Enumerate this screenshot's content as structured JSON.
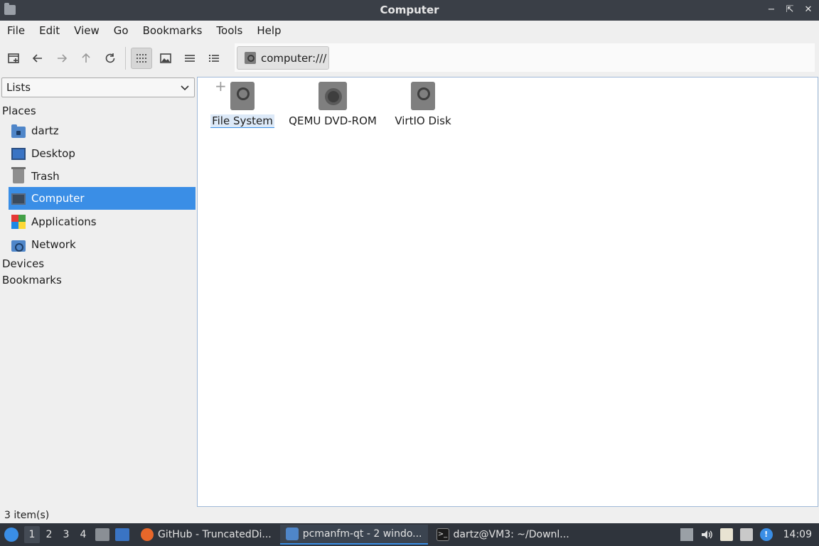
{
  "window": {
    "title": "Computer"
  },
  "menu": [
    "File",
    "Edit",
    "View",
    "Go",
    "Bookmarks",
    "Tools",
    "Help"
  ],
  "path": {
    "value": "computer:///"
  },
  "side": {
    "selector": "Lists",
    "places_header": "Places",
    "items": [
      {
        "label": "dartz",
        "icon": "home-folder-icon"
      },
      {
        "label": "Desktop",
        "icon": "desktop-icon"
      },
      {
        "label": "Trash",
        "icon": "trash-icon"
      },
      {
        "label": "Computer",
        "icon": "computer-icon"
      },
      {
        "label": "Applications",
        "icon": "applications-icon"
      },
      {
        "label": "Network",
        "icon": "network-icon"
      }
    ],
    "devices_header": "Devices",
    "bookmarks_header": "Bookmarks"
  },
  "files": [
    {
      "label": "File System",
      "icon": "drive-icon"
    },
    {
      "label": "QEMU DVD-ROM",
      "icon": "dvd-icon"
    },
    {
      "label": "VirtIO Disk",
      "icon": "drive-icon"
    }
  ],
  "status": {
    "text": "3 item(s)"
  },
  "taskbar": {
    "workspaces": [
      "1",
      "2",
      "3",
      "4"
    ],
    "tasks": [
      {
        "label": "GitHub - TruncatedDi...",
        "icon": "firefox-icon"
      },
      {
        "label": "pcmanfm-qt - 2 windo...",
        "icon": "folder-icon"
      },
      {
        "label": "dartz@VM3: ~/Downl...",
        "icon": "terminal-icon"
      }
    ],
    "clock": "14:09"
  },
  "colors": {
    "accent": "#3a8ee6",
    "titlebar": "#3a3f47",
    "taskbar": "#2f343c"
  }
}
